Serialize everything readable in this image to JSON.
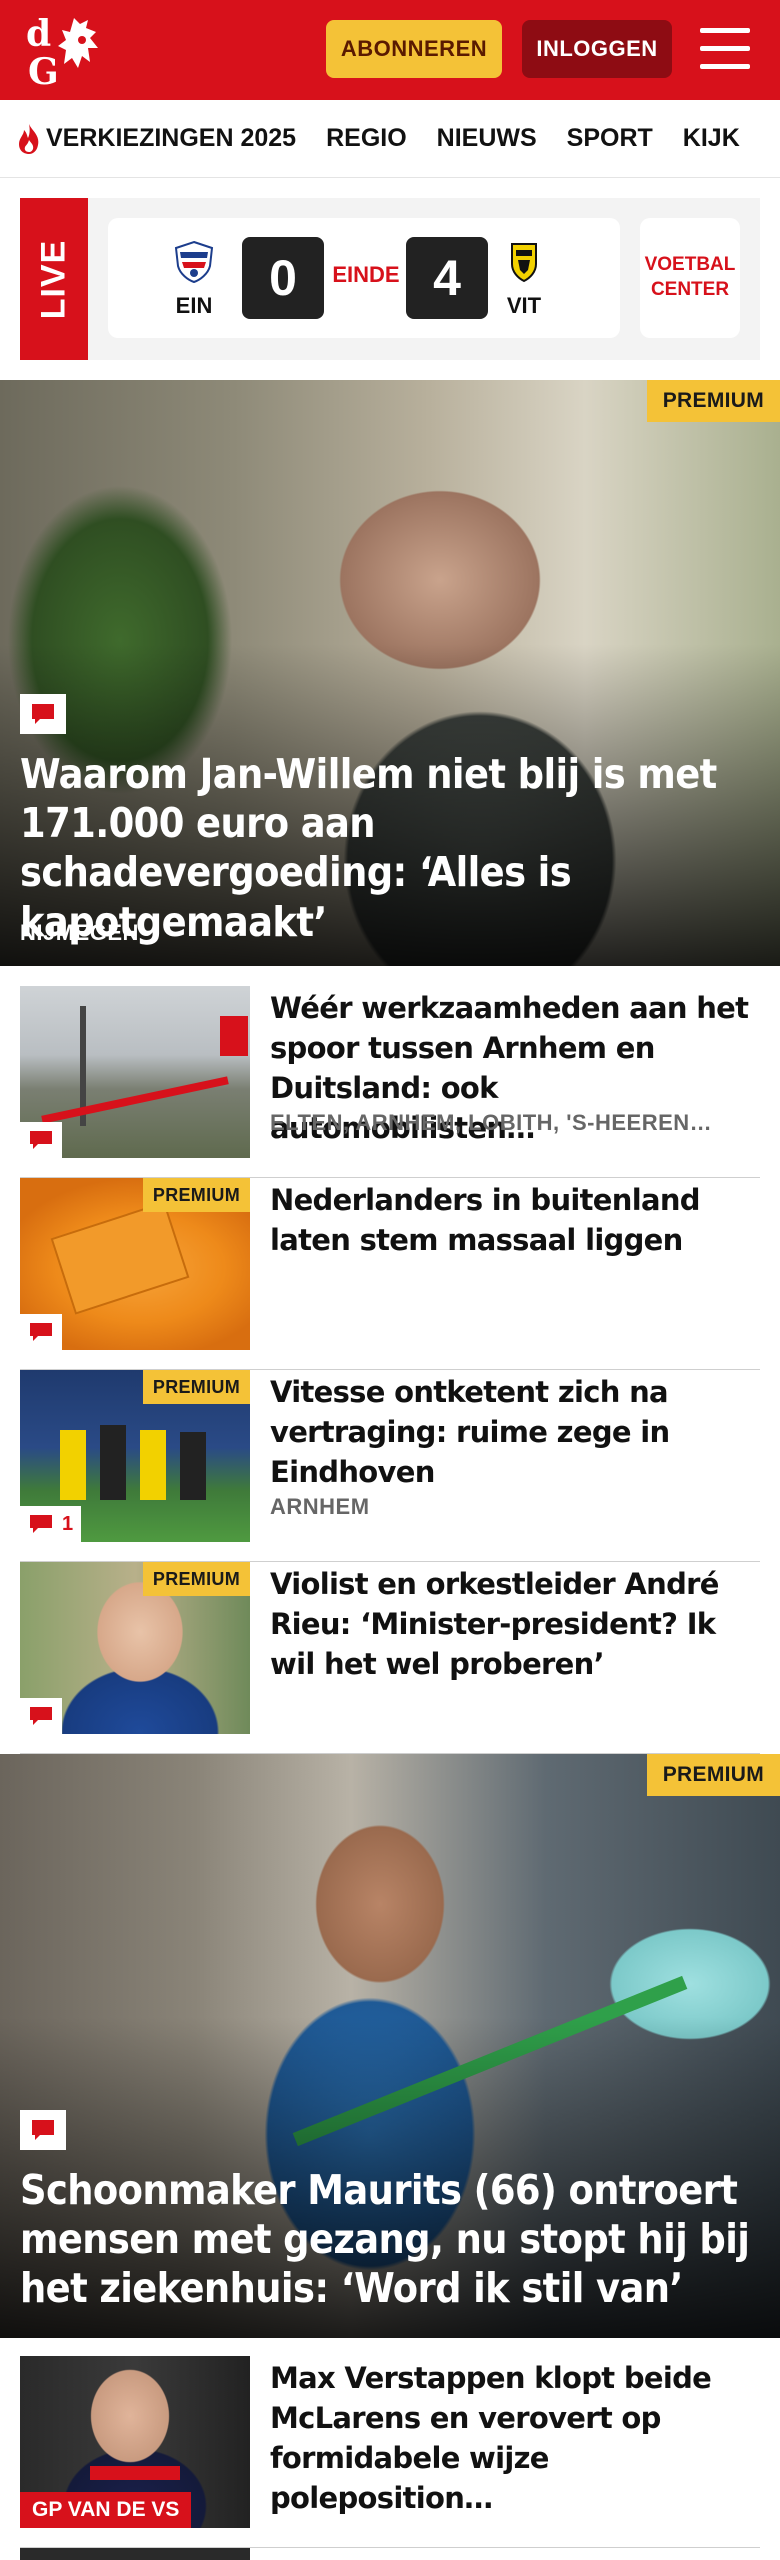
{
  "header": {
    "logo_text": "dG",
    "subscribe_label": "ABONNEREN",
    "login_label": "INLOGGEN"
  },
  "nav": {
    "items": [
      "VERKIEZINGEN 2025",
      "REGIO",
      "NIEUWS",
      "SPORT",
      "KIJK"
    ]
  },
  "live": {
    "label": "LIVE",
    "home_team": "EIN",
    "home_score": "0",
    "status": "EINDE",
    "away_score": "4",
    "away_team": "VIT",
    "center_label_1": "VOETBAL",
    "center_label_2": "CENTER"
  },
  "hero1": {
    "premium": "PREMIUM",
    "title": "Waarom Jan-Willem niet blij is met 171.000 euro aan schadevergoeding: ‘Alles is kapotgemaakt’",
    "tag": "NIJMEGEN"
  },
  "articles": [
    {
      "title": "Wéér werkzaamheden aan het spoor tussen Arnhem en Duitsland: ook automobilisten…",
      "meta": "ELTEN, ARNHEM, LOBITH, 'S-HEEREN…",
      "premium": "",
      "comments": ""
    },
    {
      "title": "Nederlanders in buitenland laten stem massaal liggen",
      "meta": "",
      "premium": "PREMIUM",
      "comments": ""
    },
    {
      "title": "Vitesse ontketent zich na vertraging: ruime zege in Eindhoven",
      "meta": "ARNHEM",
      "premium": "PREMIUM",
      "comments": "1"
    },
    {
      "title": "Violist en orkestleider André Rieu: ‘Minister-president? Ik wil het wel proberen’",
      "meta": "",
      "premium": "PREMIUM",
      "comments": ""
    }
  ],
  "hero2": {
    "premium": "PREMIUM",
    "title": "Schoonmaker Maurits (66) ontroert mensen met gezang, nu stopt hij bij het ziekenhuis: ‘Word ik stil van’"
  },
  "article5": {
    "title": "Max Verstappen klopt beide McLarens en verovert op formidabele wijze poleposition…",
    "category": "GP VAN DE VS"
  },
  "colors": {
    "brand_red": "#d7111b",
    "premium_yellow": "#f4c237",
    "login_dark_red": "#8e0c13"
  },
  "icons": [
    "menu-icon",
    "flame-icon",
    "comment-icon",
    "psv-crest-icon",
    "vitesse-crest-icon"
  ]
}
